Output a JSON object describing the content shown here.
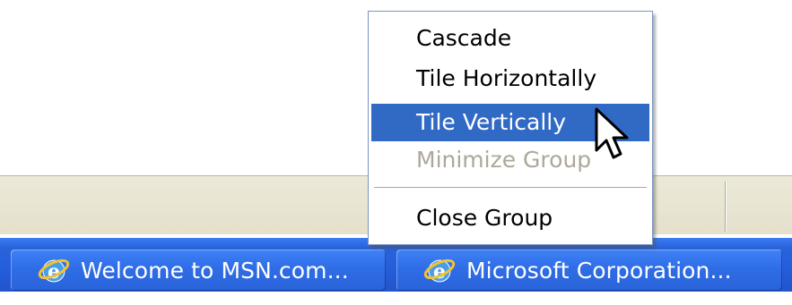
{
  "context_menu": {
    "items": [
      {
        "label": "Cascade",
        "state": "normal"
      },
      {
        "label": "Tile Horizontally",
        "state": "normal"
      },
      {
        "label": "Tile Vertically",
        "state": "highlighted"
      },
      {
        "label": "Minimize Group",
        "state": "disabled"
      },
      {
        "label": "Close Group",
        "state": "normal"
      }
    ]
  },
  "taskbar": {
    "buttons": [
      {
        "label": "Welcome to MSN.com...",
        "icon": "internet-explorer-icon"
      },
      {
        "label": "Microsoft Corporation...",
        "icon": "internet-explorer-icon"
      }
    ]
  },
  "colors": {
    "taskbar_blue": "#245edb",
    "menu_highlight": "#316ac5",
    "disabled_text": "#aca899",
    "status_bar": "#ece9d8"
  }
}
